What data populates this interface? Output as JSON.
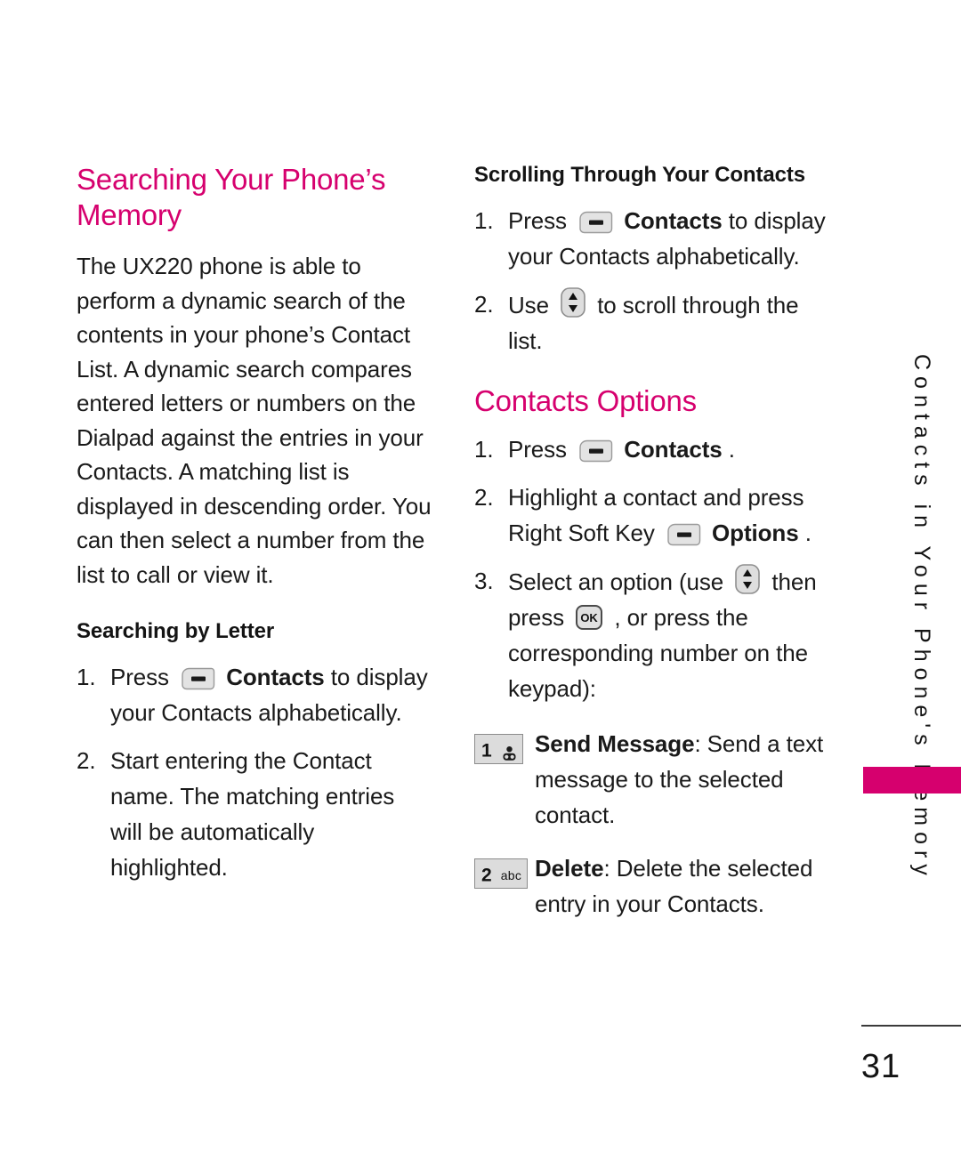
{
  "page": {
    "number": "31",
    "side_tab_label": "Contacts in Your Phone's Memory",
    "accent_color": "#D6006E"
  },
  "left_column": {
    "heading": "Searching Your Phone’s Memory",
    "intro_paragraph": "The UX220 phone is able to perform a dynamic search of the contents in your phone’s Contact List. A dynamic search compares entered letters or numbers on the Dialpad against the entries in your Contacts. A matching list is displayed in descending order. You can then select a number from the list to call or view it.",
    "subheading": "Searching by Letter",
    "steps": [
      {
        "number": "1.",
        "pre": "Press",
        "icon": "left-soft-key-icon",
        "bold": "Contacts",
        "post": "to display your Contacts alphabetically."
      },
      {
        "number": "2.",
        "pre": "Start entering the Contact name. The matching entries will be automatically highlighted.",
        "icon": "",
        "bold": "",
        "post": ""
      }
    ]
  },
  "right_column": {
    "scrolling": {
      "heading": "Scrolling Through Your Contacts",
      "steps": [
        {
          "number": "1.",
          "pre": "Press",
          "icon": "left-soft-key-icon",
          "bold": "Contacts",
          "post": "to display your Contacts alphabetically."
        },
        {
          "number": "2.",
          "pre": "Use",
          "icon": "nav-up-down-key-icon",
          "bold": "",
          "post": "to scroll through the list."
        }
      ]
    },
    "options": {
      "heading": "Contacts Options",
      "steps": [
        {
          "number": "1.",
          "pre": "Press",
          "icon": "left-soft-key-icon",
          "bold": "Contacts",
          "post": "."
        },
        {
          "number": "2.",
          "pre": "Highlight a contact and press Right Soft Key",
          "icon": "right-soft-key-icon",
          "bold": "Options",
          "post": "."
        },
        {
          "number": "3.",
          "pre": "Select an option (use",
          "icon": "nav-up-down-key-icon",
          "mid": "then press",
          "icon2": "ok-key-icon",
          "post": ", or press the corresponding number on the keypad):"
        }
      ],
      "key_items": [
        {
          "key_digit": "1",
          "key_sub": "",
          "key_icon": "voicemail-icon",
          "bold": "Send Message",
          "text": ": Send a text message to the selected contact."
        },
        {
          "key_digit": "2",
          "key_sub": "abc",
          "key_icon": "",
          "bold": "Delete",
          "text": ": Delete the selected entry in your Contacts."
        }
      ]
    }
  }
}
